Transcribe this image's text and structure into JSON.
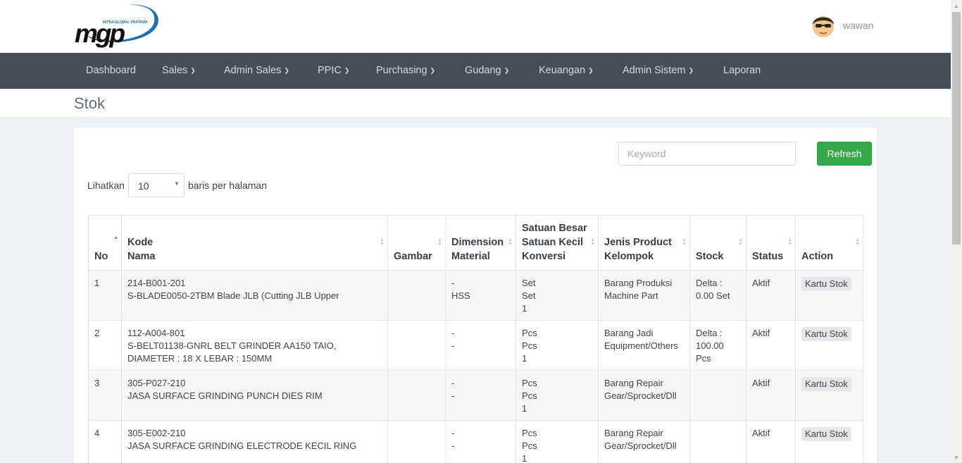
{
  "brand": {
    "logo_text": "MGP",
    "logo_tagline": "MITRA GLOBAL PRATAMA"
  },
  "user": {
    "name": "wawan"
  },
  "nav": [
    {
      "label": "Dashboard",
      "dropdown": false
    },
    {
      "label": "Sales",
      "dropdown": true
    },
    {
      "label": "Admin Sales",
      "dropdown": true
    },
    {
      "label": "PPIC",
      "dropdown": true
    },
    {
      "label": "Purchasing",
      "dropdown": true
    },
    {
      "label": "Gudang",
      "dropdown": true
    },
    {
      "label": "Keuangan",
      "dropdown": true
    },
    {
      "label": "Admin Sistem",
      "dropdown": true
    },
    {
      "label": "Laporan",
      "dropdown": false
    }
  ],
  "page": {
    "title": "Stok"
  },
  "search": {
    "placeholder": "Keyword",
    "value": ""
  },
  "refresh_label": "Refresh",
  "length": {
    "prefix": "Lihatkan",
    "value": "10",
    "suffix": "baris per halaman"
  },
  "table": {
    "headers": [
      {
        "lines": [
          "No"
        ],
        "sorted": "asc"
      },
      {
        "lines": [
          "Kode",
          "Nama"
        ]
      },
      {
        "lines": [
          "Gambar"
        ]
      },
      {
        "lines": [
          "Dimension",
          "Material"
        ]
      },
      {
        "lines": [
          "Satuan Besar",
          "Satuan Kecil",
          "Konversi"
        ]
      },
      {
        "lines": [
          "Jenis Product",
          "Kelompok"
        ]
      },
      {
        "lines": [
          "Stock"
        ]
      },
      {
        "lines": [
          "Status"
        ]
      },
      {
        "lines": [
          "Action"
        ]
      }
    ],
    "rows": [
      {
        "no": "1",
        "kode": "214-B001-201",
        "nama": "S-BLADE0050-2TBM Blade JLB (Cutting JLB Upper",
        "gambar": "",
        "dimension": "-",
        "material": "HSS",
        "satuan_besar": "Set",
        "satuan_kecil": "Set",
        "konversi": "1",
        "jenis_product": "Barang Produksi",
        "kelompok": "Machine Part",
        "stock_lines": [
          "Delta :",
          "0.00 Set"
        ],
        "status": "Aktif",
        "action": "Kartu Stok"
      },
      {
        "no": "2",
        "kode": "112-A004-801",
        "nama": "S-BELT01138-GNRL BELT GRINDER AA150 TAIO, DIAMETER : 18 X LEBAR : 150MM",
        "gambar": "",
        "dimension": "-",
        "material": "-",
        "satuan_besar": "Pcs",
        "satuan_kecil": "Pcs",
        "konversi": "1",
        "jenis_product": "Barang Jadi",
        "kelompok": "Equipment/Others",
        "stock_lines": [
          "Delta :",
          "100.00",
          "Pcs"
        ],
        "status": "Aktif",
        "action": "Kartu Stok"
      },
      {
        "no": "3",
        "kode": "305-P027-210",
        "nama": "JASA SURFACE GRINDING PUNCH DIES RIM",
        "gambar": "",
        "dimension": "-",
        "material": "-",
        "satuan_besar": "Pcs",
        "satuan_kecil": "Pcs",
        "konversi": "1",
        "jenis_product": "Barang Repair",
        "kelompok": "Gear/Sprocket/Dll",
        "stock_lines": [],
        "status": "Aktif",
        "action": "Kartu Stok"
      },
      {
        "no": "4",
        "kode": "305-E002-210",
        "nama": "JASA SURFACE GRINDING ELECTRODE KECIL RING",
        "gambar": "",
        "dimension": "-",
        "material": "-",
        "satuan_besar": "Pcs",
        "satuan_kecil": "Pcs",
        "konversi": "1",
        "jenis_product": "Barang Repair",
        "kelompok": "Gear/Sprocket/Dll",
        "stock_lines": [],
        "status": "Aktif",
        "action": "Kartu Stok"
      }
    ]
  },
  "icons": {
    "caret": "chevron-down-icon",
    "sort": "sort-icon",
    "avatar": "avatar-icon"
  },
  "colors": {
    "navbar": "#444d58",
    "refresh": "#35a94a",
    "logo_blue": "#1f6fb5"
  }
}
